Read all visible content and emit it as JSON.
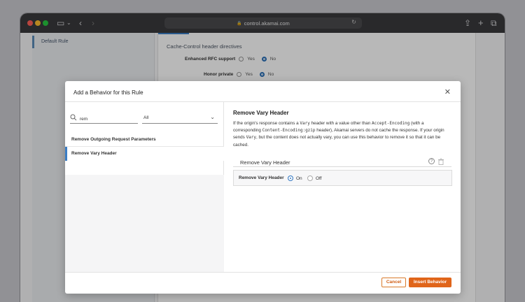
{
  "browser": {
    "url": "control.akamai.com"
  },
  "background": {
    "rail_item": "Default Rule",
    "section_heading": "Cache-Control header directives",
    "rows": [
      {
        "label": "Enhanced RFC support",
        "yes": "Yes",
        "no": "No"
      },
      {
        "label": "Honor private",
        "yes": "Yes",
        "no": "No"
      }
    ]
  },
  "modal": {
    "title": "Add a Behavior for this Rule",
    "search": {
      "value": "rem"
    },
    "filter": {
      "selected": "All"
    },
    "results": [
      "Remove Outgoing Request Parameters",
      "Remove Vary Header"
    ],
    "detail": {
      "title": "Remove Vary Header",
      "desc": {
        "p1": "If the origin's response contains a ",
        "c1": "Vary",
        "p2": " header with a value other than ",
        "c2": "Accept-Encoding",
        "p3": " (with a corresponding ",
        "c3": "Content-Encoding:gzip",
        "p4": " header), Akamai servers do not cache the response. If your origin sends ",
        "c4": "Vary",
        "p5": ", but the content does not actually vary, you can use this behavior to remove it so that it can be cached."
      },
      "subsection_title": "Remove Vary Header",
      "option_label": "Remove Vary Header",
      "on_label": "On",
      "off_label": "Off",
      "selected": "On"
    },
    "footer": {
      "cancel": "Cancel",
      "insert": "Insert Behavior"
    }
  }
}
